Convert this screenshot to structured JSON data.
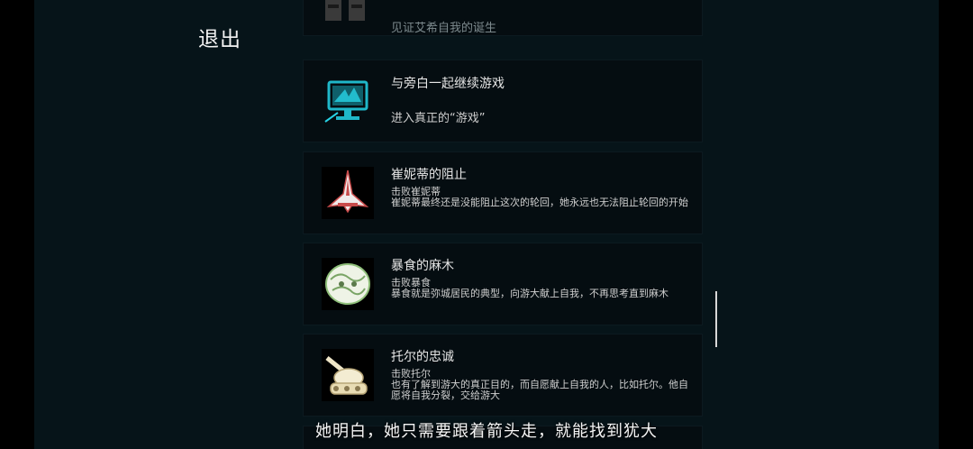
{
  "exit_label": "退出",
  "achievements": [
    {
      "title": "",
      "condition": "见证艾希自我的诞生",
      "description": "",
      "icon": "shadow-figures-icon"
    },
    {
      "title": "与旁白一起继续游戏",
      "condition": "进入真正的“游戏”",
      "description": "",
      "icon": "monitor-icon"
    },
    {
      "title": "崔妮蒂的阻止",
      "condition": "击败崔妮蒂",
      "description": "崔妮蒂最终还是没能阻止这次的轮回，她永远也无法阻止轮回的开始",
      "icon": "spaceship-icon"
    },
    {
      "title": "暴食的麻木",
      "condition": "击败暴食",
      "description": "暴食就是弥城居民的典型，向游大献上自我，不再思考直到麻木",
      "icon": "brain-creature-icon"
    },
    {
      "title": "托尔的忠诚",
      "condition": "击败托尔",
      "description": "也有了解到游大的真正目的，而自愿献上自我的人，比如托尔。他自愿将自我分裂，交给游大",
      "icon": "tank-icon"
    }
  ],
  "subtitle": "她明白，她只需要跟着箭头走，就能找到犹大",
  "colors": {
    "background": "#061419",
    "card": "#050d11",
    "text": "#e6e6e6",
    "accent": "#1fb7c9"
  }
}
